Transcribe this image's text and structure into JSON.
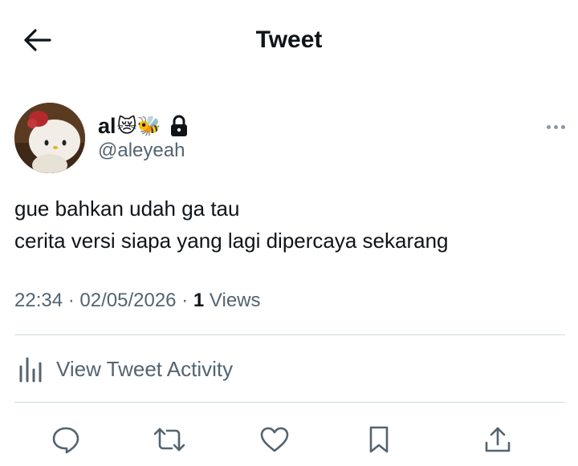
{
  "header": {
    "title": "Tweet",
    "back_icon": "arrow-left-icon"
  },
  "tweet": {
    "author": {
      "display_name": "al",
      "name_emojis": "😿🐝",
      "handle": "@aleyeah",
      "protected_icon": "lock-icon"
    },
    "text_lines": [
      "gue bahkan udah ga tau",
      "cerita versi siapa yang lagi dipercaya sekarang"
    ],
    "time": "22:34",
    "date": "02/05/2026",
    "separator": "·",
    "views_count": "1",
    "views_label": "Views"
  },
  "activity": {
    "label": "View Tweet Activity",
    "icon": "bar-chart-icon"
  },
  "actions": [
    "reply-icon",
    "retweet-icon",
    "like-icon",
    "bookmark-icon",
    "share-icon"
  ],
  "colors": {
    "text": "#0f1419",
    "secondary": "#536471",
    "divider": "#cfd9de"
  }
}
